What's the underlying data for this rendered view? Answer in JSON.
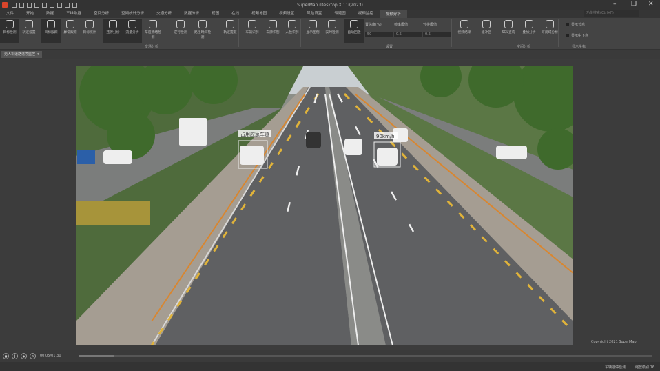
{
  "window": {
    "title": "SuperMap iDesktop X 11i(2023)"
  },
  "search": {
    "placeholder": "功能搜索(Ctrl+F)"
  },
  "menu": [
    "文件",
    "开始",
    "数据",
    "三维数据",
    "空间分析",
    "空间统计分析",
    "交通分析",
    "数据分析",
    "视图",
    "在线",
    "视频地图",
    "视频设置",
    "风险设置",
    "专题图",
    "视频监控",
    "视频分析"
  ],
  "ribbon": {
    "buttons": [
      "目标检测",
      "轨迹设置",
      "目标跟踪",
      "异常跟踪",
      "目标统计",
      "违停分析",
      "流量分析",
      "车道拥堵检测",
      "逆行检测",
      "路径时间检测",
      "轨迹提取",
      "车辆识别",
      "车牌识别",
      "人脸识别",
      "显示图例",
      "实时检测",
      "自动回放",
      "视频结果",
      "缓冲区",
      "SQL查询",
      "叠加分析",
      "可视域分析"
    ],
    "groups": [
      "交通分析",
      "设置",
      "空间分析",
      "显示坐标"
    ],
    "settings": {
      "threshold_label": "置信度(%)",
      "iou_label": "帧率阈值",
      "scale_label": "分类阈值",
      "threshold_value": "50",
      "iou_value": "0.5",
      "scale_value": "0.5"
    },
    "checks": [
      "显示节点",
      "显示中下点"
    ]
  },
  "tab": {
    "label": "无人机道路违停监控"
  },
  "video": {
    "label1": "占用应急车道",
    "label2": "90km/h",
    "copyright": "Copyright 2021 SuperMap"
  },
  "player": {
    "time": "00:05/01:30",
    "progress": 0.06
  },
  "status": {
    "left": "车辆违停检测",
    "right": "缩放级别 16"
  }
}
